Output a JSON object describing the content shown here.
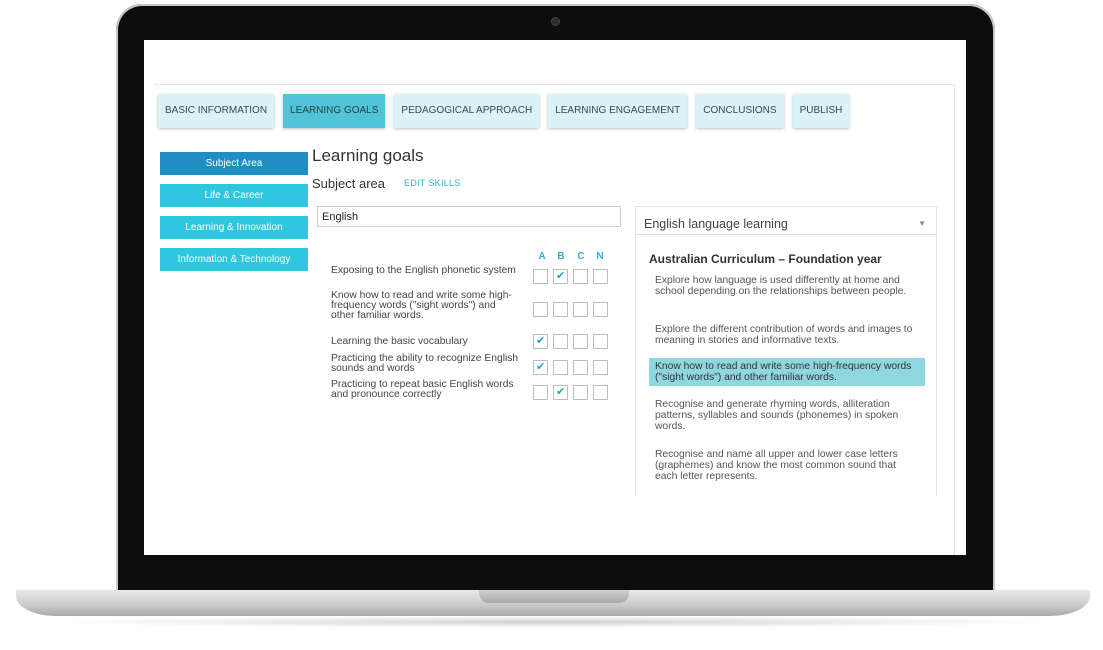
{
  "tabs": [
    {
      "label": "BASIC INFORMATION",
      "active": false
    },
    {
      "label": "LEARNING GOALS",
      "active": true
    },
    {
      "label": "PEDAGOGICAL APPROACH",
      "active": false
    },
    {
      "label": "LEARNING ENGAGEMENT",
      "active": false
    },
    {
      "label": "CONCLUSIONS",
      "active": false
    },
    {
      "label": "PUBLISH",
      "active": false
    }
  ],
  "sidebar": {
    "items": [
      {
        "label": "Subject Area",
        "active": true
      },
      {
        "label": "Life & Career",
        "active": false
      },
      {
        "label": "Learning & Innovation",
        "active": false
      },
      {
        "label": "Information & Technology",
        "active": false
      }
    ]
  },
  "main": {
    "title": "Learning goals",
    "subtitle": "Subject area",
    "edit_skills": "EDIT SKILLS",
    "subject_value": "English",
    "columns": [
      "A",
      "B",
      "C",
      "N"
    ],
    "goals": [
      {
        "text": "Exposing to the English phonetic system",
        "checked": [
          false,
          true,
          false,
          false
        ]
      },
      {
        "text": "Know how to read and write some high-frequency words (\"sight words\") and other familiar words.",
        "checked": [
          false,
          false,
          false,
          false
        ]
      },
      {
        "text": "Learning the basic vocabulary",
        "checked": [
          true,
          false,
          false,
          false
        ]
      },
      {
        "text": "Practicing the ability to recognize English sounds and words",
        "checked": [
          true,
          false,
          false,
          false
        ]
      },
      {
        "text": "Practicing to repeat basic English words and pronounce correctly",
        "checked": [
          false,
          true,
          false,
          false
        ]
      }
    ]
  },
  "curriculum": {
    "dropdown_value": "English language learning",
    "title": "Australian Curriculum – Foundation year",
    "items": [
      {
        "text": "Explore how language is used differently at home and school depending on the relationships between people.",
        "highlighted": false
      },
      {
        "text": "Explore the different contribution of words and images to meaning in stories and informative texts.",
        "highlighted": false
      },
      {
        "text": "Know how to read and write some high-frequency words (\"sight words\") and other familiar words.",
        "highlighted": true
      },
      {
        "text": "Recognise and generate rhyming words, alliteration patterns, syllables and sounds (phonemes) in spoken words.",
        "highlighted": false
      },
      {
        "text": "Recognise and name all upper and lower case letters (graphemes) and know the most common sound that each letter represents.",
        "highlighted": false
      }
    ]
  },
  "colors": {
    "tab_active": "#52c4d8",
    "tab_inactive": "#d9f3f8",
    "sidebar_active": "#1f8fc3",
    "sidebar_item": "#2fc6e0",
    "accent": "#2fb5cc",
    "highlight": "#8fd6de"
  }
}
